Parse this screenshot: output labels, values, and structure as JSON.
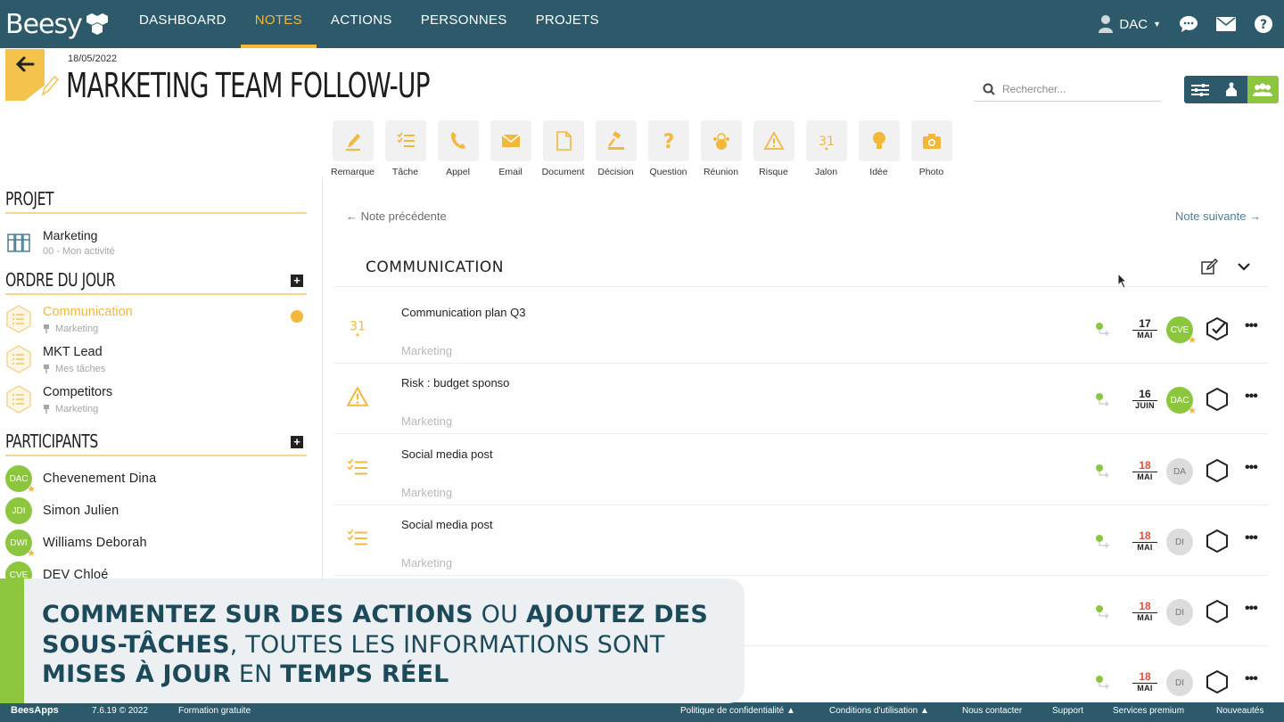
{
  "app": {
    "logo": "Beesy"
  },
  "nav": {
    "items": [
      "DASHBOARD",
      "NOTES",
      "ACTIONS",
      "PERSONNES",
      "PROJETS"
    ],
    "active": "NOTES",
    "user": "DAC"
  },
  "header": {
    "date": "18/05/2022",
    "title": "MARKETING TEAM FOLLOW-UP"
  },
  "search": {
    "placeholder": "Rechercher..."
  },
  "toolbar": [
    "Remarque",
    "Tâche",
    "Appel",
    "Email",
    "Document",
    "Décision",
    "Question",
    "Réunion",
    "Risque",
    "Jalon",
    "Idée",
    "Photo"
  ],
  "left": {
    "project_heading": "PROJET",
    "project": {
      "name": "Marketing",
      "activity": "00 - Mon activité"
    },
    "agenda_heading": "ORDRE DU JOUR",
    "agenda": [
      {
        "label": "Communication",
        "project": "Marketing"
      },
      {
        "label": "MKT Lead",
        "project": "Mes tâches"
      },
      {
        "label": "Competitors",
        "project": "Marketing"
      }
    ],
    "participants_heading": "PARTICIPANTS",
    "participants": [
      {
        "initials": "DAC",
        "name": "Chevenement Dina"
      },
      {
        "initials": "JDI",
        "name": "Simon Julien"
      },
      {
        "initials": "DWI",
        "name": "Williams Deborah"
      },
      {
        "initials": "CVE",
        "name": "DEV Chloé"
      }
    ]
  },
  "main": {
    "prev": "← Note précédente",
    "next": "Note suivante →",
    "section": "COMMUNICATION",
    "rows": [
      {
        "title": "Communication plan Q3",
        "project": "Marketing",
        "icon": "milestone-icon",
        "day": "17",
        "month": "MAI",
        "late": false,
        "assignee": "CVE",
        "assignee_style": "green",
        "star": true,
        "status": "done"
      },
      {
        "title": "Risk : budget sponso",
        "project": "Marketing",
        "icon": "risk-icon",
        "day": "16",
        "month": "JUIN",
        "late": false,
        "assignee": "DAC",
        "assignee_style": "green",
        "star": true,
        "status": "open"
      },
      {
        "title": "Social media post",
        "project": "Marketing",
        "icon": "task-icon",
        "day": "18",
        "month": "MAI",
        "late": true,
        "assignee": "DA",
        "assignee_style": "grey",
        "star": false,
        "status": "open"
      },
      {
        "title": "Social media post",
        "project": "Marketing",
        "icon": "task-icon",
        "day": "18",
        "month": "MAI",
        "late": true,
        "assignee": "DI",
        "assignee_style": "grey",
        "star": false,
        "status": "open"
      },
      {
        "title": "",
        "project": "",
        "icon": "",
        "day": "18",
        "month": "MAI",
        "late": true,
        "assignee": "DI",
        "assignee_style": "grey",
        "star": false,
        "status": "open"
      },
      {
        "title": "",
        "project": "",
        "icon": "",
        "day": "18",
        "month": "MAI",
        "late": true,
        "assignee": "DI",
        "assignee_style": "grey",
        "star": false,
        "status": "open"
      }
    ]
  },
  "banner": {
    "parts": [
      {
        "text": "COMMENTEZ SUR DES ACTIONS",
        "bold": true
      },
      {
        "text": " OU ",
        "bold": false
      },
      {
        "text": "AJOUTEZ DES SOUS-TÂCHES",
        "bold": true
      },
      {
        "text": ", TOUTES LES INFORMATIONS SONT ",
        "bold": false
      },
      {
        "text": "MISES À JOUR",
        "bold": true
      },
      {
        "text": " EN ",
        "bold": false
      },
      {
        "text": "TEMPS RÉEL",
        "bold": true
      }
    ]
  },
  "footer": {
    "brand": "BeesApps",
    "version": "7.6.19 © 2022",
    "training": "Formation gratuite",
    "privacy": "Politique de confidentialité ▲",
    "terms": "Conditions d'utilisation ▲",
    "contact": "Nous contacter",
    "support": "Support",
    "premium": "Services premium",
    "news": "Nouveautés"
  },
  "colors": {
    "nav": "#2c5a6b",
    "accent": "#f3b73a",
    "green": "#8cc63f",
    "late": "#e74c3c"
  }
}
